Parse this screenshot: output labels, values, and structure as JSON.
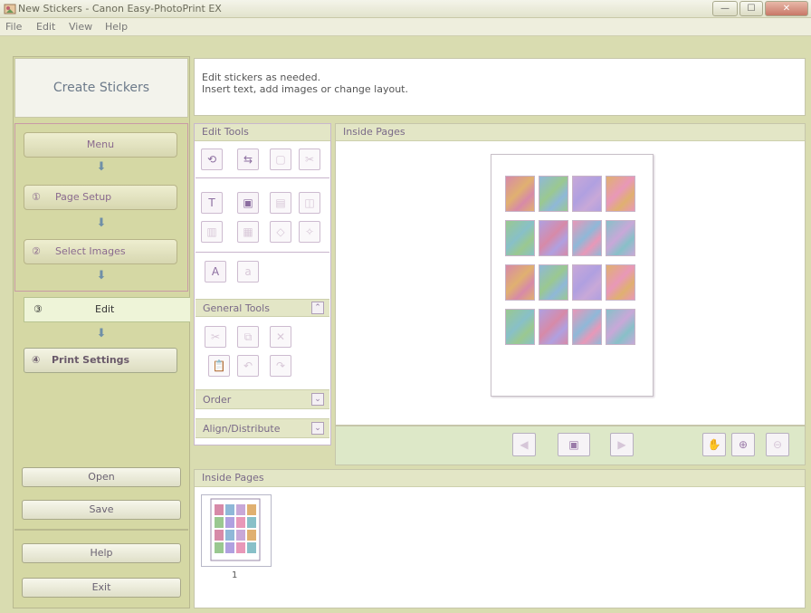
{
  "window": {
    "title": "New Stickers - Canon Easy-PhotoPrint EX",
    "min": "—",
    "max": "☐",
    "close": "✕"
  },
  "menu": [
    "File",
    "Edit",
    "View",
    "Help"
  ],
  "left": {
    "title": "Create Stickers",
    "steps": [
      {
        "num": "",
        "label": "Menu"
      },
      {
        "num": "①",
        "label": "Page Setup"
      },
      {
        "num": "②",
        "label": "Select Images"
      },
      {
        "num": "③",
        "label": "Edit"
      },
      {
        "num": "④",
        "label": "Print Settings"
      }
    ],
    "open": "Open",
    "save": "Save",
    "help": "Help",
    "exit": "Exit"
  },
  "instruction": {
    "line1": "Edit stickers as needed.",
    "line2": "Insert text, add images or change layout."
  },
  "edit_tools": {
    "header": "Edit Tools",
    "general_header": "General Tools",
    "order_header": "Order",
    "align_header": "Align/Distribute"
  },
  "preview": {
    "header": "Inside Pages"
  },
  "thumbs": {
    "header": "Inside Pages",
    "page_number": "1"
  },
  "colors": {
    "accent": "#d5d8a4",
    "panel_border": "#c8b8cc"
  }
}
